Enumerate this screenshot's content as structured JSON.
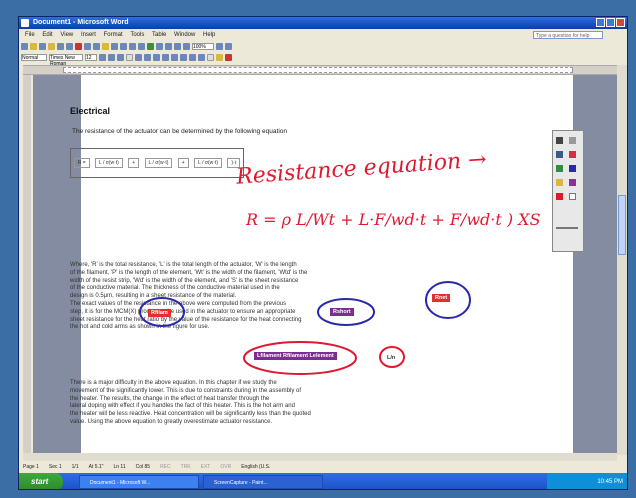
{
  "window": {
    "title": "Document1 - Microsoft Word"
  },
  "menu": [
    "File",
    "Edit",
    "View",
    "Insert",
    "Format",
    "Tools",
    "Table",
    "Window",
    "Help"
  ],
  "help_search": {
    "placeholder": "Type a question for help"
  },
  "toolbar": {
    "zoom": "100%",
    "style": "Normal",
    "font": "Times New Roman",
    "size": "12"
  },
  "document": {
    "heading": "Electrical",
    "intro": "The resistance of the actuator can be determined by the following equation",
    "equation_parts": [
      "R =",
      "L / σ(w·t)",
      "+",
      "L / σ(w·t)",
      "+",
      "L / σ(w·t)",
      ")·ℓ"
    ],
    "paragraph1": [
      "Where, 'R' is the total resistance, 'L' is the total length of the actuator, 'W' is the length",
      "of the filament, 'P' is the length of the element, 'Wt' is the width of the filament, 'Wtd' is the",
      "width of the resist strip, 'Wd' is the width of the element, and 'S' is the sheet resistance",
      "of the conductive material. The thickness of the conductive material used in the",
      "design is 0.5μm, resulting in a sheet resistance of the material.",
      "The exact values of the resistance in the above were computed from the previous",
      "step, it is for the MCM(X) process to be used in the actuator to ensure an appropriate",
      "sheet resistance for the heat ratio by the value of the resistance for the heat connecting",
      "the hot and cold arms as shown in the figure for use."
    ],
    "paragraph2": [
      "There is a major difficulty in the above equation. In this chapter if we study the",
      "movement of the significantly lower. This is due to constraints during in the assembly of",
      "the heater. The results, the change in the effect of heat transfer through the",
      "lateral doping with effect if you handles the fact of this heater. This is the hot arm and",
      "the heater will be less reactive. Heat concentration will be significantly less than the quoted",
      "value. Using the above equation to greatly overestimate actuator resistance."
    ],
    "highlights": {
      "a": "Rfilam",
      "b": "Rshort",
      "c": "Rnet",
      "d": "Lfilament Rfilament Lelement",
      "e": "L/n"
    }
  },
  "ink": {
    "title": "Resistance equation →",
    "equation": "R = ρ L/Wt + L·F/wd·t + F/wd·t ) XS"
  },
  "status": [
    "Page 1",
    "Sec 1",
    "1/1",
    "At 5.1\"",
    "Ln 11",
    "Col 85",
    "REC",
    "TRK",
    "EXT",
    "OVR",
    "English (U.S."
  ],
  "taskbar": {
    "start": "start",
    "tasks": [
      "Document1 - Microsoft W...",
      "ScreenCapture - Paint..."
    ],
    "clock": "10:45 PM"
  },
  "colors": {
    "ink_red": "#e01830",
    "circle_blue": "#2a2aa8",
    "taskbar": "#2458d4"
  }
}
